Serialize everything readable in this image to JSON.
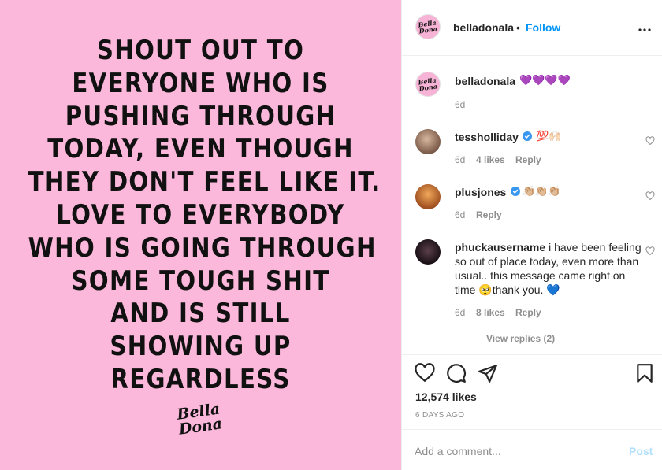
{
  "post": {
    "quote_lines": [
      "SHOUT OUT TO",
      "EVERYONE WHO IS",
      "PUSHING THROUGH",
      "TODAY, EVEN THOUGH",
      "THEY DON'T FEEL LIKE IT.",
      "LOVE TO EVERYBODY",
      "WHO IS GOING THROUGH",
      "SOME TOUGH SHIT",
      "AND IS STILL",
      "SHOWING UP",
      "REGARDLESS"
    ],
    "brand_mark": [
      "Bella",
      "Dona"
    ],
    "background": "#fbb8db"
  },
  "header": {
    "username": "belladonala",
    "dot": "•",
    "follow": "Follow",
    "more": "•••"
  },
  "caption": {
    "username": "belladonala",
    "emoji": "💜💜💜💜",
    "time": "6d"
  },
  "comments": [
    {
      "username": "tessholliday",
      "verified": true,
      "text": "💯🙌🏻",
      "time": "6d",
      "likes": "4 likes",
      "reply": "Reply"
    },
    {
      "username": "plusjones",
      "verified": true,
      "text": "👏🏼👏🏼👏🏼",
      "time": "6d",
      "reply": "Reply"
    },
    {
      "username": "phuckausername",
      "verified": false,
      "text": "i have been feeling so out of place today, even more than usual.. this message came right on time 🥺thank you. 💙",
      "time": "6d",
      "likes": "8 likes",
      "reply": "Reply",
      "view_replies": "View replies (2)"
    }
  ],
  "footer": {
    "likes": "12,574 likes",
    "ago": "6 DAYS AGO",
    "add_placeholder": "Add a comment...",
    "post": "Post"
  },
  "colors": {
    "accent": "#0095f6",
    "muted": "#8e8e8e",
    "verified": "#3897f0"
  }
}
